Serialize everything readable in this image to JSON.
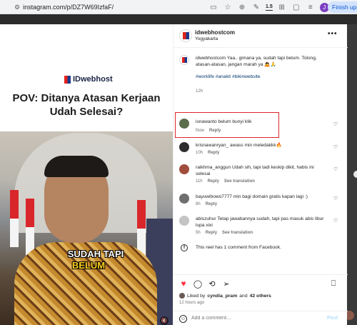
{
  "browser": {
    "url": "instagram.com/p/DZ7W69IzfaF/",
    "zoom_icon": "1.5",
    "profile_initial": "J",
    "finish_button": "Finish upda"
  },
  "media": {
    "brand": "IDwebhost",
    "headline": "POV: Ditanya Atasan Kerjaan Udah Selesai?",
    "caption_line1": "SUDAH TAPI",
    "caption_line2": "BELUM"
  },
  "post": {
    "username": "idwebhostcom",
    "location": "Yogyakarta",
    "caption": {
      "username": "idwebhostcom",
      "text": "Yaa.. gimana ya, sudah tapi belum. Tolong, atasan-atasan, jangan marah ya 🙇🙏",
      "hashtags": "#worklife #anakit #bikinwebsite",
      "age": "12h"
    },
    "comments": [
      {
        "username": "isnawanto",
        "text": "belum bunyi klik",
        "age": "Now",
        "reply": "Reply",
        "see_translation": "",
        "avatar_color": "#5b6d4a"
      },
      {
        "username": "krisnawanryan_",
        "text": "awass min meledakkk🔥",
        "age": "10h",
        "reply": "Reply",
        "see_translation": "",
        "avatar_color": "#2d2d2d"
      },
      {
        "username": "raikhma_anggun",
        "text": "Udah sih, tapi tadi keskip dikit, habis ini selesai",
        "age": "11h",
        "reply": "Reply",
        "see_translation": "See translation",
        "avatar_color": "#a14d3b"
      },
      {
        "username": "bayuwibowo7777",
        "text": "min bagi domain gratis kapan lagi :)",
        "age": "8h",
        "reply": "Reply",
        "see_translation": "",
        "avatar_color": "#6f6f6f"
      },
      {
        "username": "abiszuhur",
        "text": "Tetap jawabannya sudah, tapi pas masuk abis libur lupa xixi",
        "age": "5h",
        "reply": "Reply",
        "see_translation": "See translation",
        "avatar_color": "#c4c4c4"
      }
    ],
    "facebook_note": "This reel has 1 comment from Facebook.",
    "liked_by_prefix": "Liked by",
    "liked_by_user": "cyndia_pram",
    "liked_by_suffix": "and",
    "liked_by_others": "42 others",
    "post_age": "12 hours ago",
    "add_comment_placeholder": "Add a comment…",
    "post_label": "Post"
  }
}
